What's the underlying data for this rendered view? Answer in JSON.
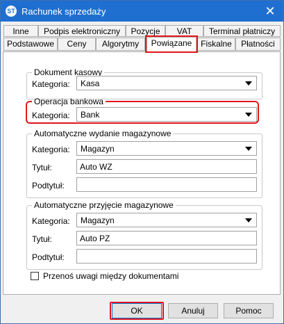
{
  "window": {
    "title": "Rachunek sprzedaży",
    "icon_text": "ST"
  },
  "tabs_row1": [
    "Inne",
    "Podpis elektroniczny",
    "Pozycje",
    "VAT",
    "Terminal płatniczy"
  ],
  "tabs_row2": [
    "Podstawowe",
    "Ceny",
    "Algorytmy",
    "Powiązane",
    "Fiskalne",
    "Płatności"
  ],
  "active_tab": "Powiązane",
  "groups": {
    "dokument_kasowy": {
      "legend": "Dokument kasowy",
      "kategoria_label": "Kategoria:",
      "kategoria_value": "Kasa"
    },
    "operacja_bankowa": {
      "legend": "Operacja bankowa",
      "kategoria_label": "Kategoria:",
      "kategoria_value": "Bank"
    },
    "wydanie": {
      "legend": "Automatyczne wydanie magazynowe",
      "kategoria_label": "Kategoria:",
      "kategoria_value": "Magazyn",
      "tytul_label": "Tytuł:",
      "tytul_value": "Auto WZ",
      "podtytul_label": "Podtytuł:",
      "podtytul_value": ""
    },
    "przyjecie": {
      "legend": "Automatyczne przyjęcie magazynowe",
      "kategoria_label": "Kategoria:",
      "kategoria_value": "Magazyn",
      "tytul_label": "Tytuł:",
      "tytul_value": "Auto PZ",
      "podtytul_label": "Podtytuł:",
      "podtytul_value": ""
    }
  },
  "checkbox": {
    "label": "Przenoś uwagi między dokumentami",
    "checked": false
  },
  "buttons": {
    "ok": "OK",
    "cancel": "Anuluj",
    "help": "Pomoc"
  },
  "colors": {
    "titlebar": "#1f6fd0",
    "highlight": "#e0161b"
  }
}
